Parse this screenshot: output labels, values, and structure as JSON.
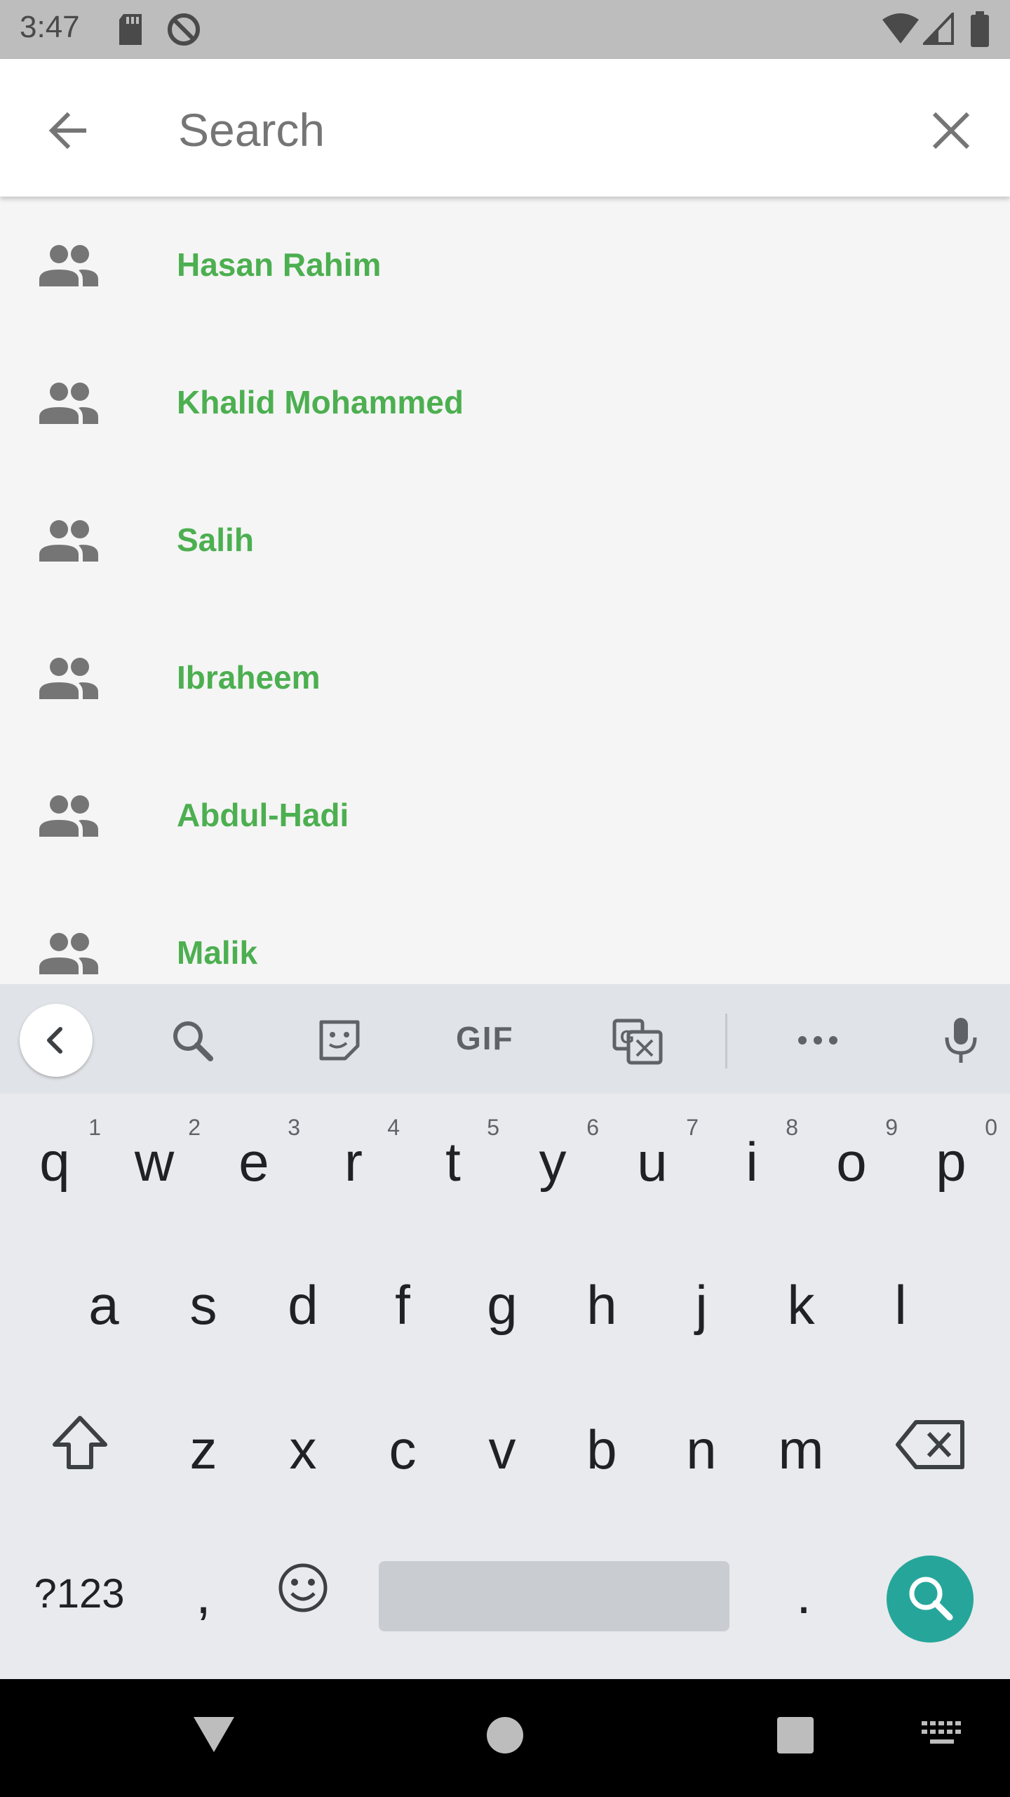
{
  "status_bar": {
    "time": "3:47",
    "icons": [
      "sd-card-icon",
      "do-not-disturb-icon",
      "wifi-icon",
      "signal-icon",
      "battery-icon"
    ]
  },
  "search": {
    "placeholder": "Search",
    "value": ""
  },
  "results": [
    {
      "name": "Hasan Rahim"
    },
    {
      "name": "Khalid Mohammed"
    },
    {
      "name": "Salih"
    },
    {
      "name": "Ibraheem"
    },
    {
      "name": "Abdul-Hadi"
    },
    {
      "name": "Malik"
    }
  ],
  "colors": {
    "accent_green": "#4caf50",
    "search_key": "#26a69a",
    "status_bar": "#bdbdbd"
  },
  "keyboard": {
    "toolbar": [
      "back-chevron-icon",
      "search-icon",
      "sticker-icon",
      "gif-icon",
      "translate-icon",
      "more-icon",
      "mic-icon"
    ],
    "gif_label": "GIF",
    "row1": [
      {
        "ch": "q",
        "hint": "1"
      },
      {
        "ch": "w",
        "hint": "2"
      },
      {
        "ch": "e",
        "hint": "3"
      },
      {
        "ch": "r",
        "hint": "4"
      },
      {
        "ch": "t",
        "hint": "5"
      },
      {
        "ch": "y",
        "hint": "6"
      },
      {
        "ch": "u",
        "hint": "7"
      },
      {
        "ch": "i",
        "hint": "8"
      },
      {
        "ch": "o",
        "hint": "9"
      },
      {
        "ch": "p",
        "hint": "0"
      }
    ],
    "row2": [
      "a",
      "s",
      "d",
      "f",
      "g",
      "h",
      "j",
      "k",
      "l"
    ],
    "row3": [
      "z",
      "x",
      "c",
      "v",
      "b",
      "n",
      "m"
    ],
    "symbols_label": "?123",
    "comma_label": ",",
    "period_label": "."
  },
  "nav_bar": [
    "back-triangle-icon",
    "home-circle-icon",
    "recents-square-icon",
    "keyboard-switch-icon"
  ]
}
